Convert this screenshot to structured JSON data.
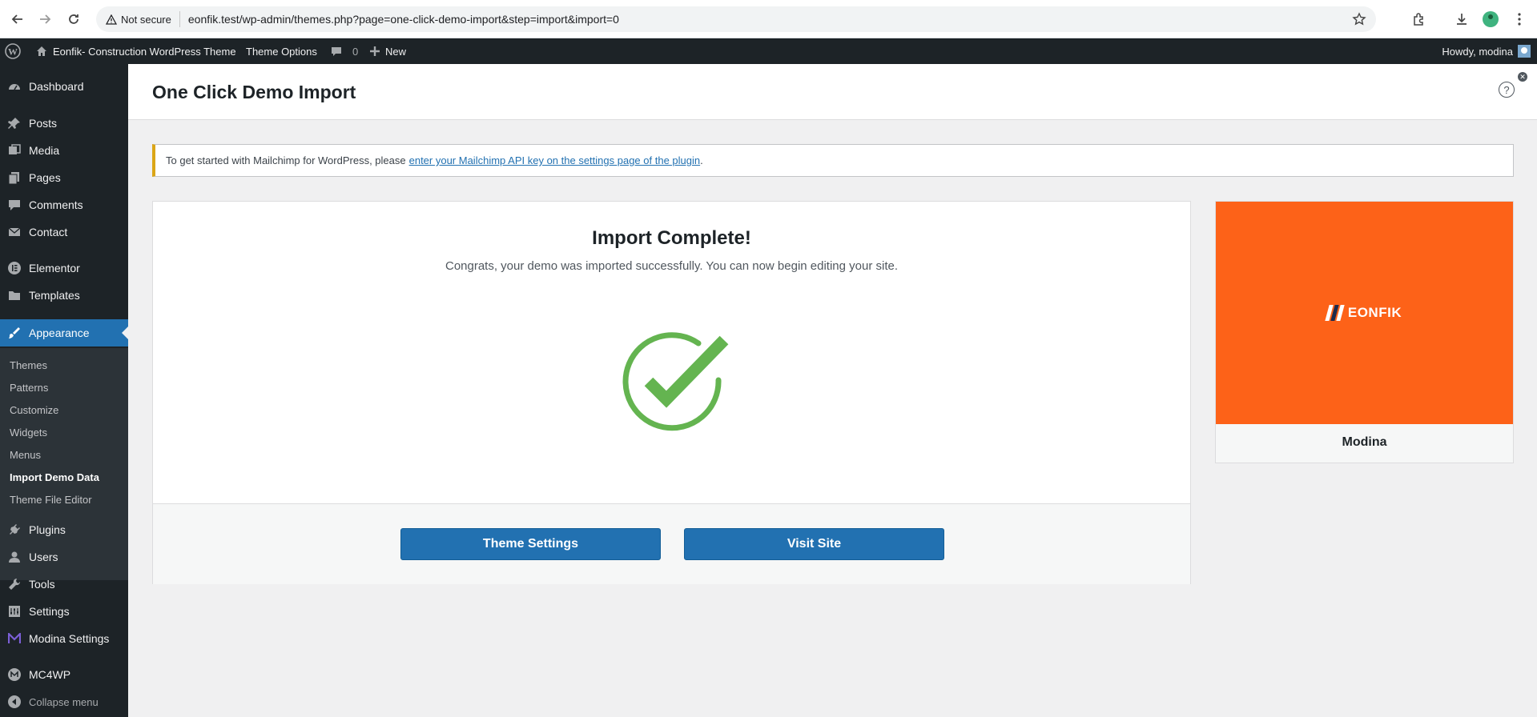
{
  "browser": {
    "security_label": "Not secure",
    "url": "eonfik.test/wp-admin/themes.php?page=one-click-demo-import&step=import&import=0"
  },
  "adminbar": {
    "site_name": "Eonfik- Construction WordPress Theme",
    "theme_options": "Theme Options",
    "comments_count": "0",
    "new_label": "New",
    "howdy": "Howdy, modina"
  },
  "sidebar": {
    "items": [
      {
        "label": "Dashboard",
        "icon": "dashboard-icon"
      },
      {
        "label": "Posts",
        "icon": "pin-icon"
      },
      {
        "label": "Media",
        "icon": "media-icon"
      },
      {
        "label": "Pages",
        "icon": "pages-icon"
      },
      {
        "label": "Comments",
        "icon": "comment-icon"
      },
      {
        "label": "Contact",
        "icon": "mail-icon"
      },
      {
        "label": "Elementor",
        "icon": "elementor-icon"
      },
      {
        "label": "Templates",
        "icon": "folder-icon"
      },
      {
        "label": "Appearance",
        "icon": "brush-icon"
      },
      {
        "label": "Plugins",
        "icon": "plugin-icon"
      },
      {
        "label": "Users",
        "icon": "user-icon"
      },
      {
        "label": "Tools",
        "icon": "wrench-icon"
      },
      {
        "label": "Settings",
        "icon": "settings-icon"
      },
      {
        "label": "Modina Settings",
        "icon": "modina-icon"
      },
      {
        "label": "MC4WP",
        "icon": "mc4wp-icon"
      },
      {
        "label": "Collapse menu",
        "icon": "collapse-icon"
      }
    ],
    "submenu": [
      "Themes",
      "Patterns",
      "Customize",
      "Widgets",
      "Menus",
      "Import Demo Data",
      "Theme File Editor"
    ]
  },
  "page": {
    "title": "One Click Demo Import"
  },
  "notice": {
    "text": "To get started with Mailchimp for WordPress, please",
    "link": "enter your Mailchimp API key on the settings page of the plugin",
    "end": "."
  },
  "import": {
    "title": "Import Complete!",
    "subtitle": "Congrats, your demo was imported successfully. You can now begin editing your site.",
    "theme_settings_button": "Theme Settings",
    "visit_site_button": "Visit Site"
  },
  "theme": {
    "logo_text": "EONFIK",
    "name": "Modina",
    "brand_color": "#fd6218"
  },
  "colors": {
    "wp_blue": "#2271b1",
    "success_green": "#64b450",
    "admin_dark": "#1d2327"
  }
}
